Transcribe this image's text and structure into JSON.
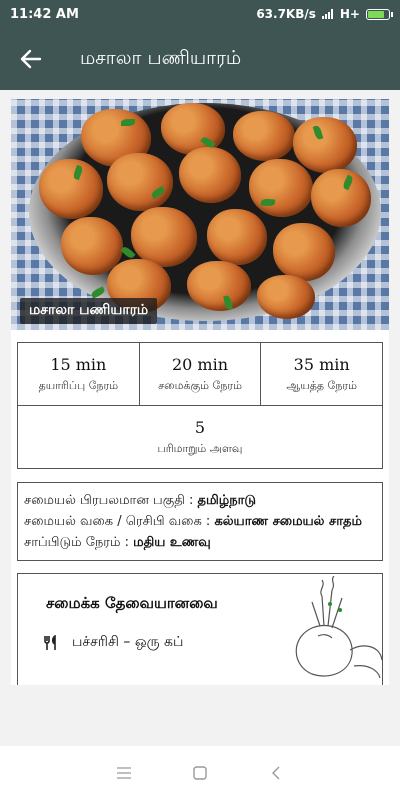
{
  "status_bar": {
    "time": "11:42 AM",
    "network_speed": "63.7KB/s",
    "network_type": "H+",
    "battery_level": 0.85,
    "icons": [
      "signal-icon",
      "battery-charging-icon"
    ]
  },
  "app_bar": {
    "title": "மசாலா பணியாரம்",
    "back_icon": "arrow-left-icon"
  },
  "recipe": {
    "image_caption": "மசாலா பணியாரம்",
    "times": [
      {
        "value": "15 min",
        "label": "தயாரிப்பு நேரம்"
      },
      {
        "value": "20 min",
        "label": "சமைக்கும் நேரம்"
      },
      {
        "value": "35 min",
        "label": "ஆயத்த நேரம்"
      }
    ],
    "servings": {
      "value": "5",
      "label": "பரிமாறும் அளவு"
    },
    "meta": {
      "region_label": "சமையல் பிரபலமான பகுதி : ",
      "region_value": "தமிழ்நாடு",
      "type_label": "சமையல் வகை / ரெசிபி வகை : ",
      "type_value": "கல்யாண சமையல் சாதம்",
      "meal_label": "சாப்பிடும் நேரம் : ",
      "meal_value": "மதிய உணவு"
    },
    "ingredients": {
      "heading": "சமைக்க தேவையானவை",
      "icon": "cutlery-icon",
      "items": [
        "பச்சரிசி – ஒரு கப்"
      ]
    }
  },
  "nav_bar": {
    "icons": [
      "menu-icon",
      "home-square-icon",
      "back-triangle-icon"
    ]
  },
  "colors": {
    "app_bar": "#3f5553",
    "background": "#f2f2f2",
    "card": "#ffffff",
    "border": "#555555"
  }
}
